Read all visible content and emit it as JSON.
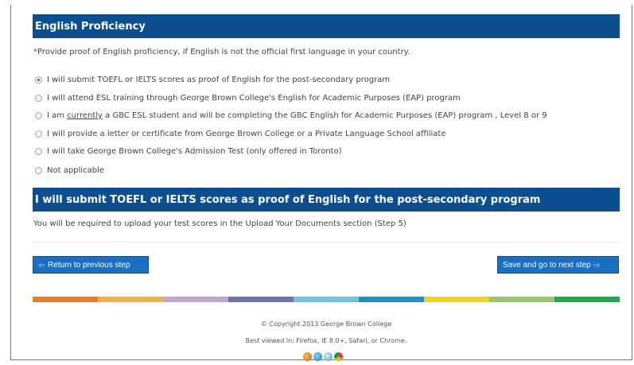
{
  "section1": {
    "title": "English Proficiency",
    "required_mark": "*",
    "intro": "Provide proof of English proficiency, if English is not the official first language in your country."
  },
  "options": [
    {
      "label": "I will submit TOEFL or IELTS scores as proof of English for the post-secondary program",
      "checked": true
    },
    {
      "label": "I will attend ESL training through George Brown College's English for Academic Purposes (EAP) program",
      "checked": false
    },
    {
      "label_pre": "I am ",
      "label_link": "currently",
      "label_post": " a GBC ESL student and will be completing the GBC English for Academic Purposes (EAP) program , Level 8 or 9",
      "checked": false
    },
    {
      "label": "I will provide a letter or certificate from George Brown College or a Private Language School affiliate",
      "checked": false
    },
    {
      "label": "I will take George Brown College's Admission Test (only offered in Toronto)",
      "checked": false
    },
    {
      "label": "Not applicable",
      "checked": false
    }
  ],
  "section2": {
    "title": "I will submit TOEFL or IELTS scores as proof of English for the post-secondary program",
    "note": "You will be required to upload your test scores in the Upload Your Documents section (Step 5)"
  },
  "buttons": {
    "prev_label": "Return to previous step",
    "next_label": "Save and go to next step"
  },
  "footer": {
    "copyright": "© Copyright 2013 George Brown College",
    "browsers": "Best viewed in: Firefox, IE 8.0+, Safari, or Chrome."
  },
  "colors": {
    "header_bg": "#0b4f91",
    "button_bg": "#1a6fc4",
    "colorbar": [
      "#ee7a2c",
      "#f6b042",
      "#c0a8d1",
      "#6d72b7",
      "#6cc3ec",
      "#1b8fd0",
      "#f7d21a",
      "#9ac769",
      "#1caa4f"
    ]
  },
  "icons": [
    "arrow-left-icon",
    "arrow-right-icon",
    "firefox-icon",
    "ie-icon",
    "safari-icon",
    "chrome-icon"
  ]
}
